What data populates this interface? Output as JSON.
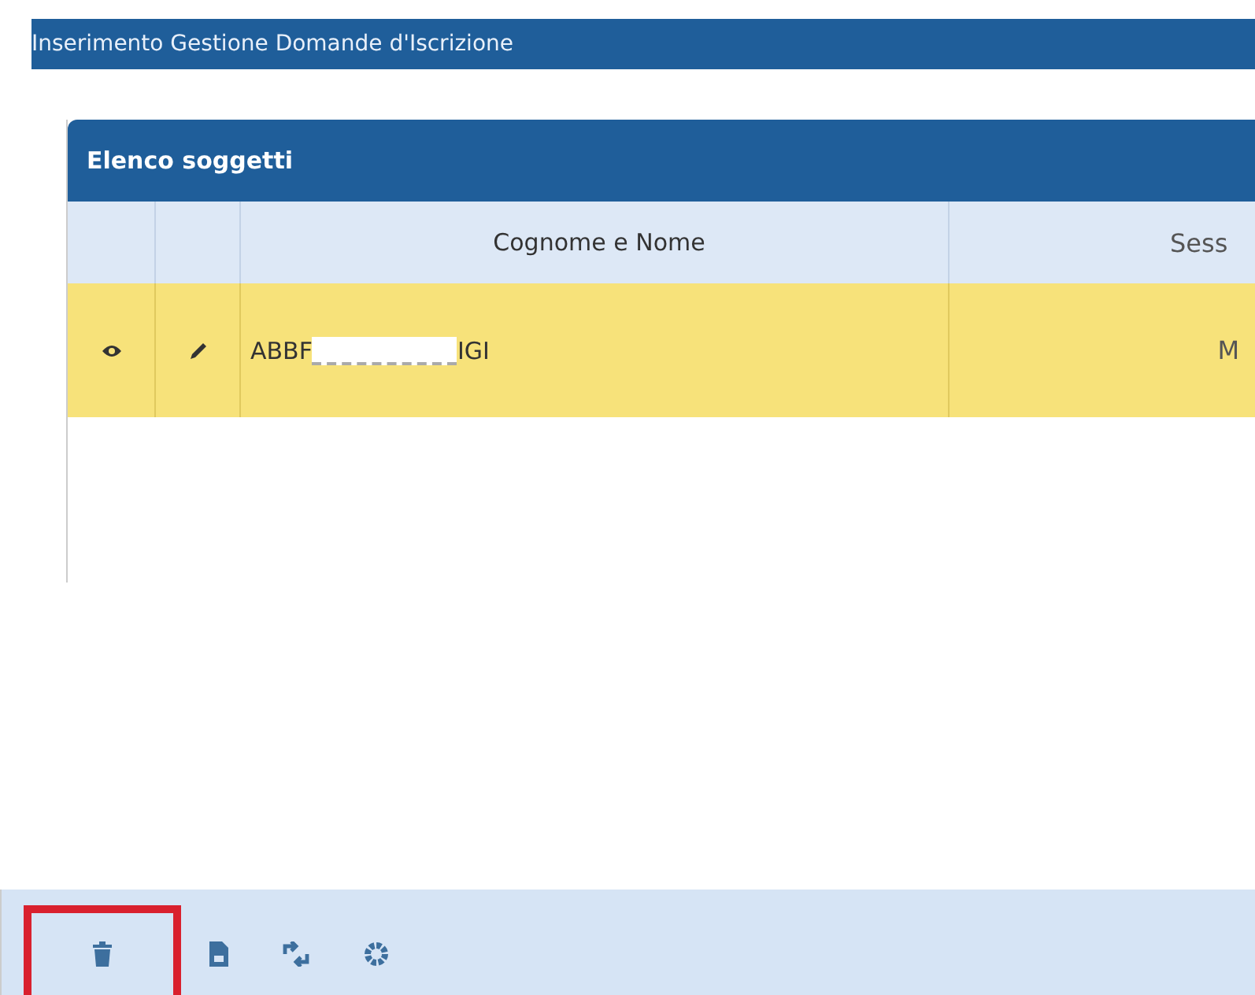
{
  "window": {
    "title": "Inserimento Gestione Domande d'Iscrizione"
  },
  "panel": {
    "title": "Elenco soggetti"
  },
  "table": {
    "columns": [
      "",
      "",
      "Cognome e Nome",
      "Sess"
    ],
    "rows": [
      {
        "selected": true,
        "name_start": "ABBF",
        "name_redacted": true,
        "name_end": "IGI",
        "sex": "M"
      }
    ]
  },
  "toolbar": {
    "buttons": [
      {
        "kind": "delete",
        "highlighted": true
      },
      {
        "kind": "save",
        "highlighted": false
      },
      {
        "kind": "refresh",
        "highlighted": false
      },
      {
        "kind": "settings",
        "highlighted": false
      }
    ]
  }
}
